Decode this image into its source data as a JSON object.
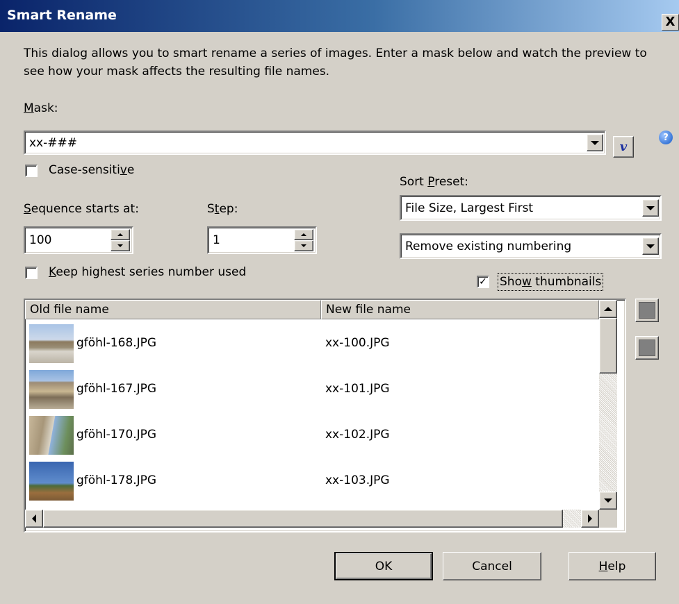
{
  "window": {
    "title": "Smart Rename",
    "close_glyph": "X"
  },
  "description": "This dialog allows you to smart rename a series of images. Enter a mask below and watch the preview to see how your mask affects the resulting file names.",
  "mask": {
    "label_key": "M",
    "label_rest": "ask:",
    "value": "xx-###",
    "v_button": "v"
  },
  "case_sensitive": {
    "label_pre": "Case-sensiti",
    "label_key": "v",
    "label_post": "e",
    "checked": false
  },
  "sequence": {
    "label_key": "S",
    "label_rest": "equence starts at:",
    "value": "100"
  },
  "step": {
    "label_pre": "S",
    "label_key": "t",
    "label_post": "ep:",
    "value": "1"
  },
  "keep_highest": {
    "label_key": "K",
    "label_rest": "eep highest series number used",
    "checked": false
  },
  "sort_preset": {
    "label_pre": "Sort ",
    "label_key": "P",
    "label_post": "reset:",
    "value": "File Size, Largest First"
  },
  "numbering": {
    "value": "Remove existing numbering"
  },
  "show_thumbnails": {
    "label_pre": "Sho",
    "label_key": "w",
    "label_post": " thumbnails",
    "checked": true
  },
  "list": {
    "columns": [
      "Old file name",
      "New file name"
    ],
    "rows": [
      {
        "old": "gföhl-168.JPG",
        "new": "xx-100.JPG"
      },
      {
        "old": "gföhl-167.JPG",
        "new": "xx-101.JPG"
      },
      {
        "old": "gföhl-170.JPG",
        "new": "xx-102.JPG"
      },
      {
        "old": "gföhl-178.JPG",
        "new": "xx-103.JPG"
      }
    ]
  },
  "buttons": {
    "ok": "OK",
    "cancel": "Cancel",
    "help_key": "H",
    "help_rest": "elp"
  },
  "colors": {
    "title_start": "#0a246a",
    "title_end": "#a6caf0",
    "face": "#d4d0c8",
    "help_icon": "#3a78d8"
  }
}
